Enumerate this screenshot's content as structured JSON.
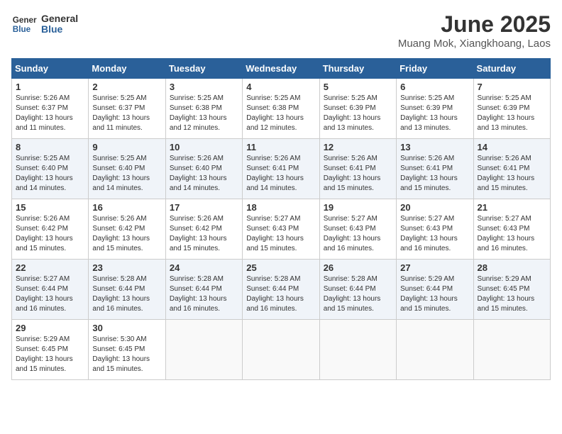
{
  "header": {
    "logo_line1": "General",
    "logo_line2": "Blue",
    "title": "June 2025",
    "subtitle": "Muang Mok, Xiangkhoang, Laos"
  },
  "weekdays": [
    "Sunday",
    "Monday",
    "Tuesday",
    "Wednesday",
    "Thursday",
    "Friday",
    "Saturday"
  ],
  "weeks": [
    [
      {
        "day": "1",
        "sunrise": "Sunrise: 5:26 AM",
        "sunset": "Sunset: 6:37 PM",
        "daylight": "Daylight: 13 hours and 11 minutes."
      },
      {
        "day": "2",
        "sunrise": "Sunrise: 5:25 AM",
        "sunset": "Sunset: 6:37 PM",
        "daylight": "Daylight: 13 hours and 11 minutes."
      },
      {
        "day": "3",
        "sunrise": "Sunrise: 5:25 AM",
        "sunset": "Sunset: 6:38 PM",
        "daylight": "Daylight: 13 hours and 12 minutes."
      },
      {
        "day": "4",
        "sunrise": "Sunrise: 5:25 AM",
        "sunset": "Sunset: 6:38 PM",
        "daylight": "Daylight: 13 hours and 12 minutes."
      },
      {
        "day": "5",
        "sunrise": "Sunrise: 5:25 AM",
        "sunset": "Sunset: 6:39 PM",
        "daylight": "Daylight: 13 hours and 13 minutes."
      },
      {
        "day": "6",
        "sunrise": "Sunrise: 5:25 AM",
        "sunset": "Sunset: 6:39 PM",
        "daylight": "Daylight: 13 hours and 13 minutes."
      },
      {
        "day": "7",
        "sunrise": "Sunrise: 5:25 AM",
        "sunset": "Sunset: 6:39 PM",
        "daylight": "Daylight: 13 hours and 13 minutes."
      }
    ],
    [
      {
        "day": "8",
        "sunrise": "Sunrise: 5:25 AM",
        "sunset": "Sunset: 6:40 PM",
        "daylight": "Daylight: 13 hours and 14 minutes."
      },
      {
        "day": "9",
        "sunrise": "Sunrise: 5:25 AM",
        "sunset": "Sunset: 6:40 PM",
        "daylight": "Daylight: 13 hours and 14 minutes."
      },
      {
        "day": "10",
        "sunrise": "Sunrise: 5:26 AM",
        "sunset": "Sunset: 6:40 PM",
        "daylight": "Daylight: 13 hours and 14 minutes."
      },
      {
        "day": "11",
        "sunrise": "Sunrise: 5:26 AM",
        "sunset": "Sunset: 6:41 PM",
        "daylight": "Daylight: 13 hours and 14 minutes."
      },
      {
        "day": "12",
        "sunrise": "Sunrise: 5:26 AM",
        "sunset": "Sunset: 6:41 PM",
        "daylight": "Daylight: 13 hours and 15 minutes."
      },
      {
        "day": "13",
        "sunrise": "Sunrise: 5:26 AM",
        "sunset": "Sunset: 6:41 PM",
        "daylight": "Daylight: 13 hours and 15 minutes."
      },
      {
        "day": "14",
        "sunrise": "Sunrise: 5:26 AM",
        "sunset": "Sunset: 6:41 PM",
        "daylight": "Daylight: 13 hours and 15 minutes."
      }
    ],
    [
      {
        "day": "15",
        "sunrise": "Sunrise: 5:26 AM",
        "sunset": "Sunset: 6:42 PM",
        "daylight": "Daylight: 13 hours and 15 minutes."
      },
      {
        "day": "16",
        "sunrise": "Sunrise: 5:26 AM",
        "sunset": "Sunset: 6:42 PM",
        "daylight": "Daylight: 13 hours and 15 minutes."
      },
      {
        "day": "17",
        "sunrise": "Sunrise: 5:26 AM",
        "sunset": "Sunset: 6:42 PM",
        "daylight": "Daylight: 13 hours and 15 minutes."
      },
      {
        "day": "18",
        "sunrise": "Sunrise: 5:27 AM",
        "sunset": "Sunset: 6:43 PM",
        "daylight": "Daylight: 13 hours and 15 minutes."
      },
      {
        "day": "19",
        "sunrise": "Sunrise: 5:27 AM",
        "sunset": "Sunset: 6:43 PM",
        "daylight": "Daylight: 13 hours and 16 minutes."
      },
      {
        "day": "20",
        "sunrise": "Sunrise: 5:27 AM",
        "sunset": "Sunset: 6:43 PM",
        "daylight": "Daylight: 13 hours and 16 minutes."
      },
      {
        "day": "21",
        "sunrise": "Sunrise: 5:27 AM",
        "sunset": "Sunset: 6:43 PM",
        "daylight": "Daylight: 13 hours and 16 minutes."
      }
    ],
    [
      {
        "day": "22",
        "sunrise": "Sunrise: 5:27 AM",
        "sunset": "Sunset: 6:44 PM",
        "daylight": "Daylight: 13 hours and 16 minutes."
      },
      {
        "day": "23",
        "sunrise": "Sunrise: 5:28 AM",
        "sunset": "Sunset: 6:44 PM",
        "daylight": "Daylight: 13 hours and 16 minutes."
      },
      {
        "day": "24",
        "sunrise": "Sunrise: 5:28 AM",
        "sunset": "Sunset: 6:44 PM",
        "daylight": "Daylight: 13 hours and 16 minutes."
      },
      {
        "day": "25",
        "sunrise": "Sunrise: 5:28 AM",
        "sunset": "Sunset: 6:44 PM",
        "daylight": "Daylight: 13 hours and 16 minutes."
      },
      {
        "day": "26",
        "sunrise": "Sunrise: 5:28 AM",
        "sunset": "Sunset: 6:44 PM",
        "daylight": "Daylight: 13 hours and 15 minutes."
      },
      {
        "day": "27",
        "sunrise": "Sunrise: 5:29 AM",
        "sunset": "Sunset: 6:44 PM",
        "daylight": "Daylight: 13 hours and 15 minutes."
      },
      {
        "day": "28",
        "sunrise": "Sunrise: 5:29 AM",
        "sunset": "Sunset: 6:45 PM",
        "daylight": "Daylight: 13 hours and 15 minutes."
      }
    ],
    [
      {
        "day": "29",
        "sunrise": "Sunrise: 5:29 AM",
        "sunset": "Sunset: 6:45 PM",
        "daylight": "Daylight: 13 hours and 15 minutes."
      },
      {
        "day": "30",
        "sunrise": "Sunrise: 5:30 AM",
        "sunset": "Sunset: 6:45 PM",
        "daylight": "Daylight: 13 hours and 15 minutes."
      },
      null,
      null,
      null,
      null,
      null
    ]
  ]
}
